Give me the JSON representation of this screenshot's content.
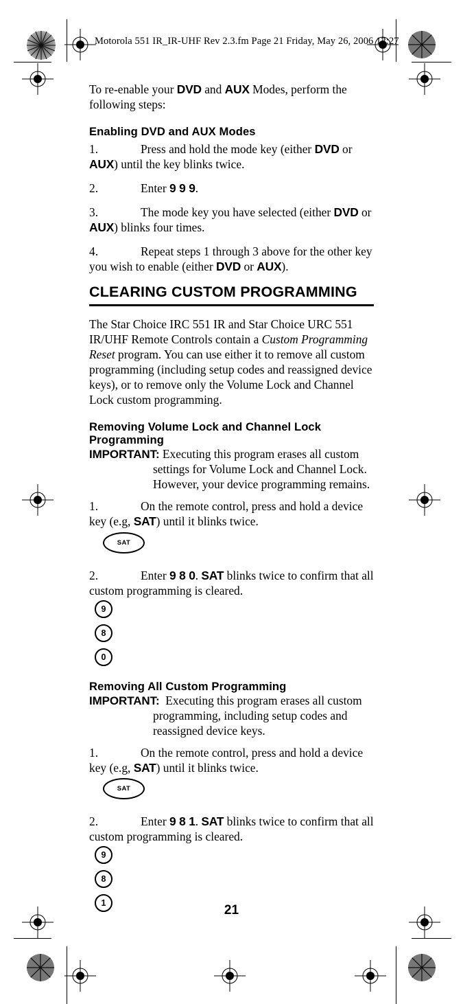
{
  "header": {
    "running_head": "Motorola 551 IR_IR-UHF Rev 2.3.fm  Page 21  Friday, May 26, 2006  12:27"
  },
  "intro": {
    "line_a": "To re-enable your ",
    "dvd": "DVD",
    "line_b": " and ",
    "aux": "AUX",
    "line_c": " Modes, perform the following steps:"
  },
  "enabling": {
    "heading": "Enabling DVD and AUX Modes",
    "steps": [
      {
        "num": "1.",
        "a": "Press and hold the mode key (either ",
        "k1": "DVD",
        "b": " or ",
        "k2": "AUX",
        "c": ") until the key blinks twice."
      },
      {
        "num": "2.",
        "a": "Enter ",
        "k1": "9 9 9",
        "c": "."
      },
      {
        "num": "3.",
        "a": "The mode key you have selected (either ",
        "k1": "DVD",
        "b": " or ",
        "k2": "AUX",
        "c": ") blinks four times."
      },
      {
        "num": "4.",
        "a": "Repeat steps 1 through 3 above for the other key you wish to enable (either ",
        "k1": "DVD",
        "b": " or ",
        "k2": "AUX",
        "c": ")."
      }
    ]
  },
  "clearing": {
    "heading": "CLEARING CUSTOM PROGRAMMING",
    "paragraph_a": "The Star Choice IRC 551 IR and Star Choice URC 551 IR/UHF Remote Controls contain a ",
    "paragraph_italic": "Custom Programming Reset",
    "paragraph_b": " program. You can use either it to remove all custom programming (including setup codes and reassigned device keys), or to remove only the Volume Lock and Channel Lock custom programming."
  },
  "removing_volume_lock": {
    "heading": "Removing Volume Lock and Channel Lock Programming",
    "important_label": "IMPORTANT:",
    "important_text": "Executing this program erases all custom settings for Volume Lock and Channel Lock. However, your device programming remains.",
    "steps": [
      {
        "num": "1.",
        "a": "On the remote control, press and hold a device key (e.g, ",
        "k1": "SAT",
        "c": ") until it blinks twice.",
        "key_icon": "SAT"
      },
      {
        "num": "2.",
        "a": "Enter ",
        "k1": "9  8  0",
        "b": ". ",
        "k2": "SAT",
        "c": " blinks twice to confirm that all custom programming is cleared.",
        "key_icons": [
          "9",
          "8",
          "0"
        ]
      }
    ]
  },
  "removing_all": {
    "heading": "Removing All Custom Programming",
    "important_label": "IMPORTANT:",
    "important_text": "Executing this program erases all custom programming, including setup codes and reassigned device keys.",
    "steps": [
      {
        "num": "1.",
        "a": "On the remote control, press and hold a device key (e.g, ",
        "k1": "SAT",
        "c": ") until it blinks twice.",
        "key_icon": "SAT"
      },
      {
        "num": "2.",
        "a": "Enter ",
        "k1": "9  8  1",
        "b": ". ",
        "k2": "SAT",
        "c": " blinks twice to confirm that all custom programming is cleared.",
        "key_icons": [
          "9",
          "8",
          "1"
        ]
      }
    ]
  },
  "footer": {
    "page_number": "21"
  },
  "colors": {
    "ink": "#000000",
    "paper": "#ffffff"
  }
}
